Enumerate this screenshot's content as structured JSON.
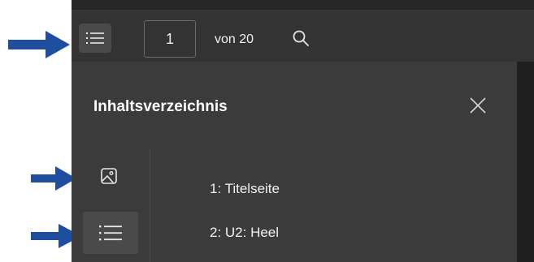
{
  "toolbar": {
    "page_current": "1",
    "page_total_label": "von 20",
    "icons": {
      "toc_toggle": "list-icon",
      "search": "search-icon"
    }
  },
  "panel": {
    "title": "Inhaltsverzeichnis",
    "close_icon": "close-icon",
    "rail_icons": [
      "image-icon",
      "list-icon"
    ],
    "items": [
      {
        "label": "1: Titelseite"
      },
      {
        "label": "2: U2: Heel"
      }
    ]
  },
  "annotations": {
    "arrow_color": "#1f4e9e"
  },
  "colors": {
    "toolbar_bg": "#333333",
    "panel_bg": "#3b3b3b",
    "text": "#f0f0f0"
  }
}
